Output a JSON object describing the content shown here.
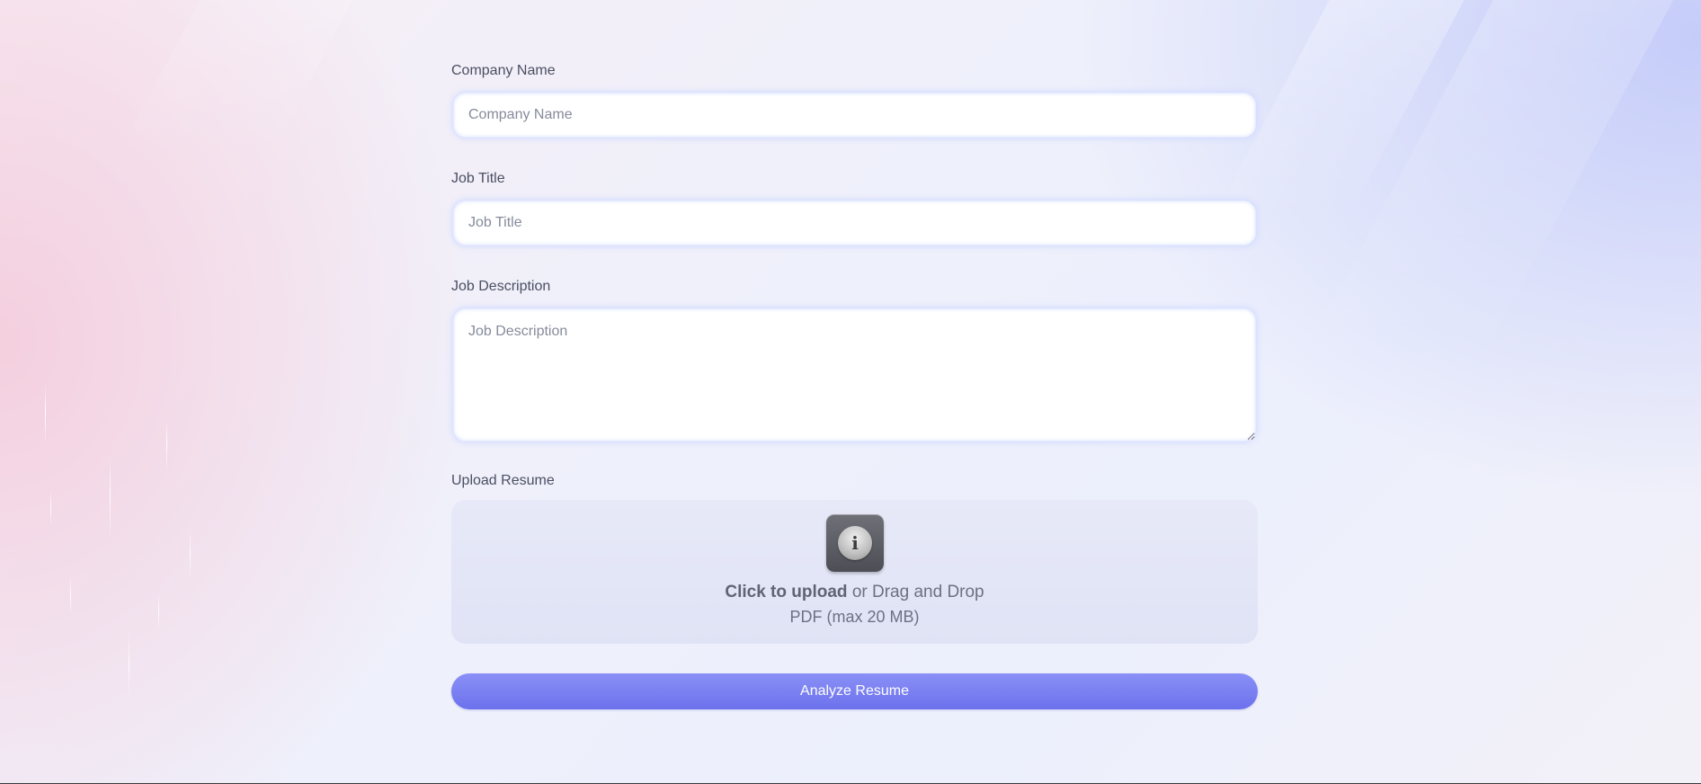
{
  "form": {
    "company": {
      "label": "Company Name",
      "placeholder": "Company Name"
    },
    "job_title": {
      "label": "Job Title",
      "placeholder": "Job Title"
    },
    "job_description": {
      "label": "Job Description",
      "placeholder": "Job Description"
    },
    "upload": {
      "label": "Upload Resume",
      "icon": "info-icon",
      "click_text": "Click to upload",
      "drag_text": " or Drag and Drop",
      "hint": "PDF (max 20 MB)"
    },
    "submit_label": "Analyze Resume"
  },
  "colors": {
    "accent": "#7177ef",
    "background": "#eef0fb"
  }
}
